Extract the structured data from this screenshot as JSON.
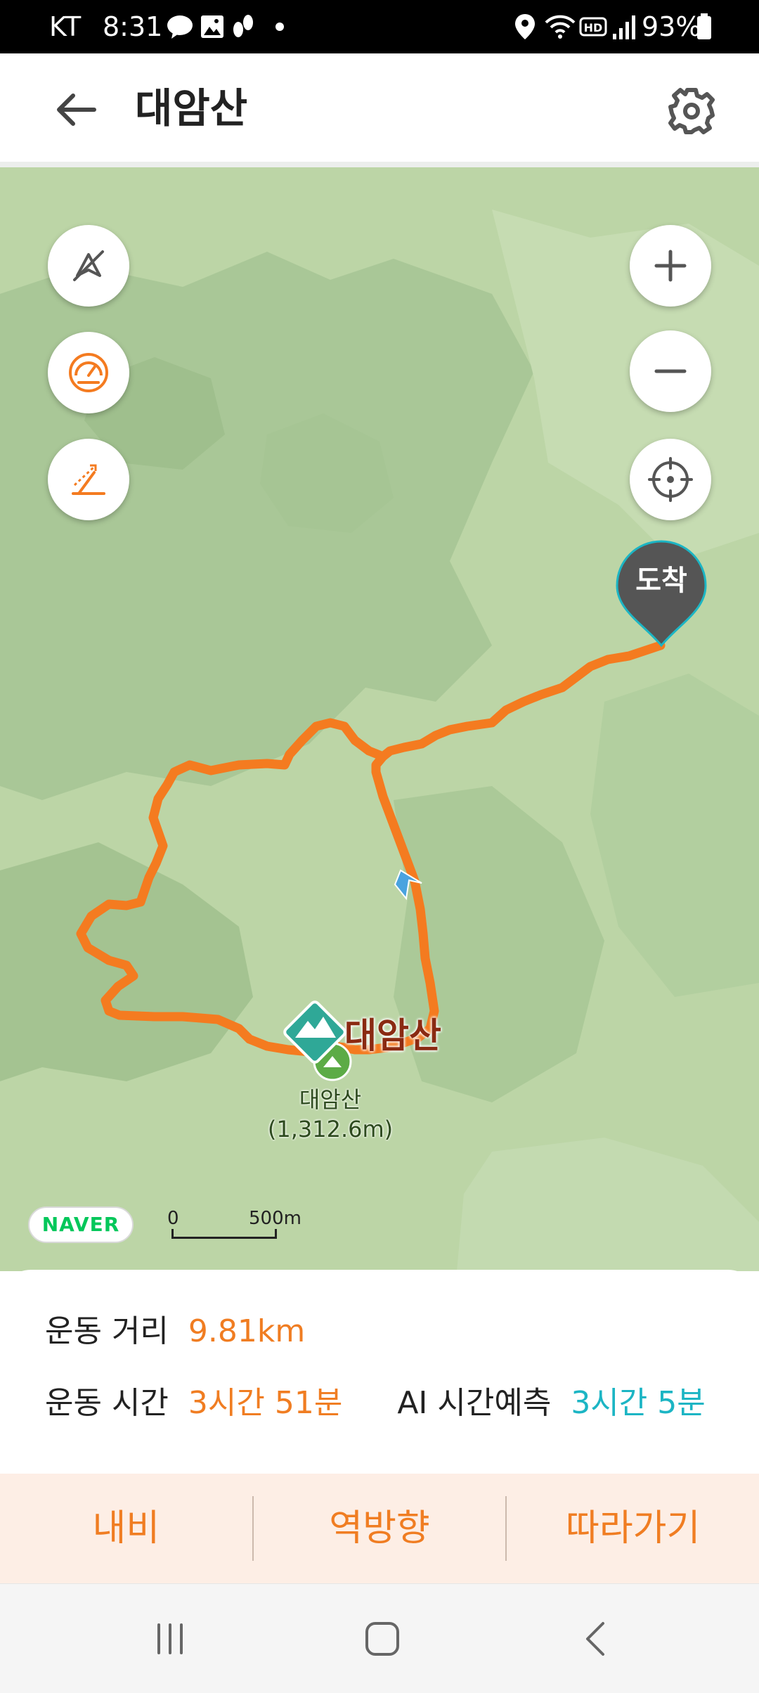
{
  "status_bar": {
    "carrier": "KT",
    "time": "8:31",
    "battery_percent": "93%",
    "icons": [
      "talk-icon",
      "gallery-icon",
      "steps-icon",
      "dot-icon",
      "location-icon",
      "wifi-icon",
      "hd-icon",
      "signal-icon",
      "battery-icon"
    ]
  },
  "header": {
    "title": "대암산",
    "back_icon": "arrow-left-icon",
    "settings_icon": "gear-icon"
  },
  "map": {
    "left_buttons": [
      "compass-off-icon",
      "speedometer-icon",
      "slope-icon"
    ],
    "right_buttons": [
      "zoom-in-icon",
      "zoom-out-icon",
      "my-location-icon"
    ],
    "arrival_label": "도착",
    "peak_label": "대암산",
    "peak_name": "대암산",
    "peak_elevation": "(1,312.6m)",
    "naver_logo": "NAVER",
    "scale_start": "0",
    "scale_end": "500m",
    "route_color": "#f47b20"
  },
  "stats": {
    "distance_label": "운동 거리",
    "distance_value": "9.81km",
    "time_label": "운동 시간",
    "time_value": "3시간 51분",
    "ai_label": "AI 시간예측",
    "ai_value": "3시간 5분"
  },
  "actions": {
    "navigate": "내비",
    "reverse": "역방향",
    "follow": "따라가기"
  },
  "nav_bar": {
    "icons": [
      "recents-icon",
      "home-icon",
      "back-icon"
    ]
  },
  "colors": {
    "accent": "#f07d22",
    "teal": "#1cb5c4",
    "map_bg": "#b9d2a4",
    "action_bg": "#fdeee5"
  }
}
